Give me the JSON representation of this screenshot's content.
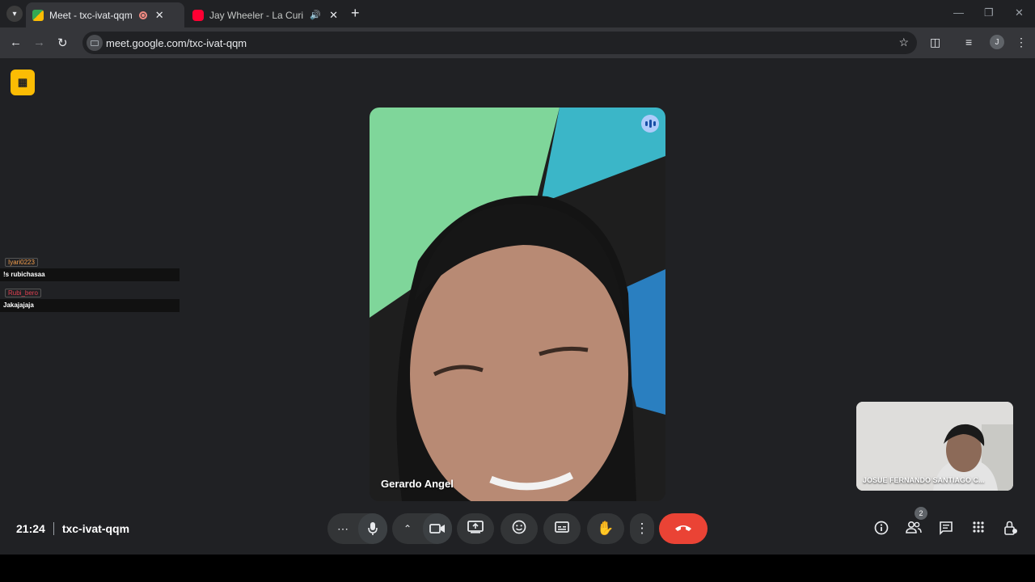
{
  "browser": {
    "tabs": [
      {
        "title": "Meet - txc-ivat-qqm",
        "active": true
      },
      {
        "title": "Jay Wheeler - La Curiosidad",
        "active": false
      }
    ],
    "url": "meet.google.com/txc-ivat-qqm",
    "profile_initial": "J"
  },
  "chat": [
    {
      "user": "Iyari0223",
      "user_color": "#f6a04d",
      "message": "!s rubichasaa"
    },
    {
      "user": "Rubi_bero",
      "user_color": "#e04050",
      "message": "Jakajajaja"
    }
  ],
  "main_participant": {
    "name": "Gerardo Angel"
  },
  "self_participant": {
    "name": "JOSUE FERNANDO SANTIAGO C..."
  },
  "meeting": {
    "time": "21:24",
    "code": "txc-ivat-qqm",
    "participant_count": "2"
  },
  "colors": {
    "end_call": "#ea4335",
    "stage_bg": "#202124",
    "speaking": "#aecbfa",
    "badge": "#fbbc04"
  }
}
